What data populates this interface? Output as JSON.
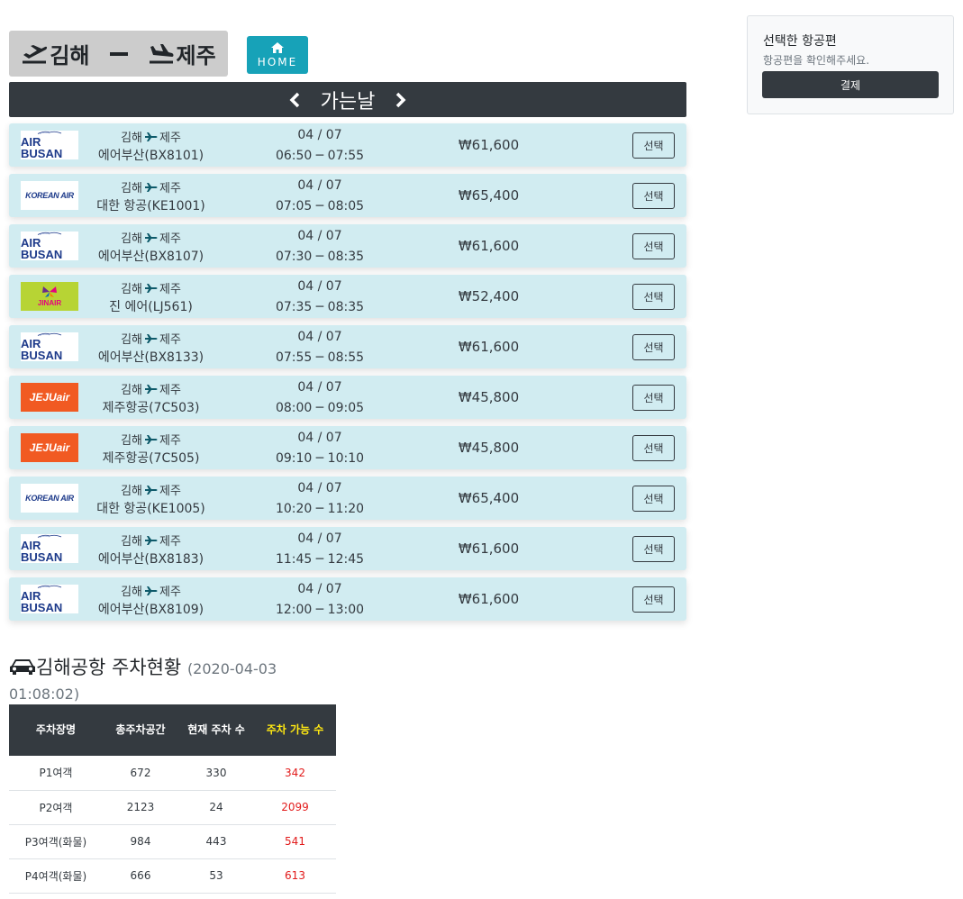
{
  "header": {
    "origin": "김해",
    "destination": "제주",
    "home_label": "HOME",
    "date_label": "가는날"
  },
  "flights": [
    {
      "logo": "airbusan",
      "origin": "김해",
      "dest": "제주",
      "airline": "에어부산(BX8101)",
      "date": "04 / 07",
      "time": "06:50 ─ 07:55",
      "price": "₩61,600",
      "select_label": "선택"
    },
    {
      "logo": "korean",
      "origin": "김해",
      "dest": "제주",
      "airline": "대한 항공(KE1001)",
      "date": "04 / 07",
      "time": "07:05 ─ 08:05",
      "price": "₩65,400",
      "select_label": "선택"
    },
    {
      "logo": "airbusan",
      "origin": "김해",
      "dest": "제주",
      "airline": "에어부산(BX8107)",
      "date": "04 / 07",
      "time": "07:30 ─ 08:35",
      "price": "₩61,600",
      "select_label": "선택"
    },
    {
      "logo": "jinair",
      "origin": "김해",
      "dest": "제주",
      "airline": "진 에어(LJ561)",
      "date": "04 / 07",
      "time": "07:35 ─ 08:35",
      "price": "₩52,400",
      "select_label": "선택"
    },
    {
      "logo": "airbusan",
      "origin": "김해",
      "dest": "제주",
      "airline": "에어부산(BX8133)",
      "date": "04 / 07",
      "time": "07:55 ─ 08:55",
      "price": "₩61,600",
      "select_label": "선택"
    },
    {
      "logo": "jeju",
      "origin": "김해",
      "dest": "제주",
      "airline": "제주항공(7C503)",
      "date": "04 / 07",
      "time": "08:00 ─ 09:05",
      "price": "₩45,800",
      "select_label": "선택"
    },
    {
      "logo": "jeju",
      "origin": "김해",
      "dest": "제주",
      "airline": "제주항공(7C505)",
      "date": "04 / 07",
      "time": "09:10 ─ 10:10",
      "price": "₩45,800",
      "select_label": "선택"
    },
    {
      "logo": "korean",
      "origin": "김해",
      "dest": "제주",
      "airline": "대한 항공(KE1005)",
      "date": "04 / 07",
      "time": "10:20 ─ 11:20",
      "price": "₩65,400",
      "select_label": "선택"
    },
    {
      "logo": "airbusan",
      "origin": "김해",
      "dest": "제주",
      "airline": "에어부산(BX8183)",
      "date": "04 / 07",
      "time": "11:45 ─ 12:45",
      "price": "₩61,600",
      "select_label": "선택"
    },
    {
      "logo": "airbusan",
      "origin": "김해",
      "dest": "제주",
      "airline": "에어부산(BX8109)",
      "date": "04 / 07",
      "time": "12:00 ─ 13:00",
      "price": "₩61,600",
      "select_label": "선택"
    }
  ],
  "logos": {
    "airbusan": "AIR BUSAN",
    "korean": "KOREAN AIR",
    "jinair": "JINAIR",
    "jeju": "JEJUair"
  },
  "side_panel": {
    "title": "선택한 항공편",
    "subtitle": "항공편을 확인해주세요.",
    "pay_label": "결제"
  },
  "parking": {
    "title": "김해공항 주차현황",
    "timestamp": "(2020-04-03 01:08:02)",
    "headers": [
      "주차장명",
      "총주차공간",
      "현재 주차 수",
      "주차 가능 수"
    ],
    "rows": [
      [
        "P1여객",
        "672",
        "330",
        "342"
      ],
      [
        "P2여객",
        "2123",
        "24",
        "2099"
      ],
      [
        "P3여객(화물)",
        "984",
        "443",
        "541"
      ],
      [
        "P4여객(화물)",
        "666",
        "53",
        "613"
      ]
    ]
  },
  "colors": {
    "dark": "#343a40",
    "flight_bg": "#d1ecf1",
    "home_btn": "#17a2b8",
    "available": "#e21b1b",
    "available_header": "#ffe812"
  }
}
